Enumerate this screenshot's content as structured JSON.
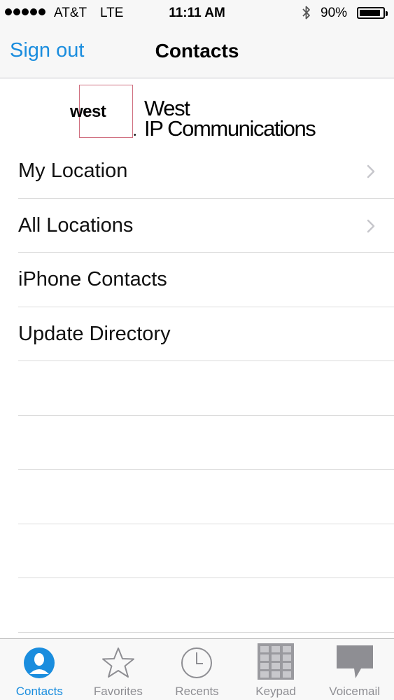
{
  "status_bar": {
    "carrier": "AT&T",
    "network": "LTE",
    "time": "11:11 AM",
    "battery_percent": "90%",
    "battery_level": 0.9
  },
  "nav": {
    "sign_out_label": "Sign out",
    "title": "Contacts"
  },
  "logo": {
    "mark_text": "west",
    "line1": "West",
    "line2": "IP Communications",
    "accent_color": "#d07080"
  },
  "list": {
    "items": [
      {
        "label": "My Location",
        "chevron": true
      },
      {
        "label": "All Locations",
        "chevron": true
      },
      {
        "label": "iPhone Contacts",
        "chevron": false
      },
      {
        "label": "Update Directory",
        "chevron": false
      }
    ]
  },
  "tabs": [
    {
      "label": "Contacts",
      "icon": "contacts-icon",
      "active": true
    },
    {
      "label": "Favorites",
      "icon": "star-icon",
      "active": false
    },
    {
      "label": "Recents",
      "icon": "clock-icon",
      "active": false
    },
    {
      "label": "Keypad",
      "icon": "keypad-icon",
      "active": false
    },
    {
      "label": "Voicemail",
      "icon": "voicemail-icon",
      "active": false
    }
  ],
  "colors": {
    "accent": "#1a8dde",
    "inactive": "#8e8e93"
  }
}
